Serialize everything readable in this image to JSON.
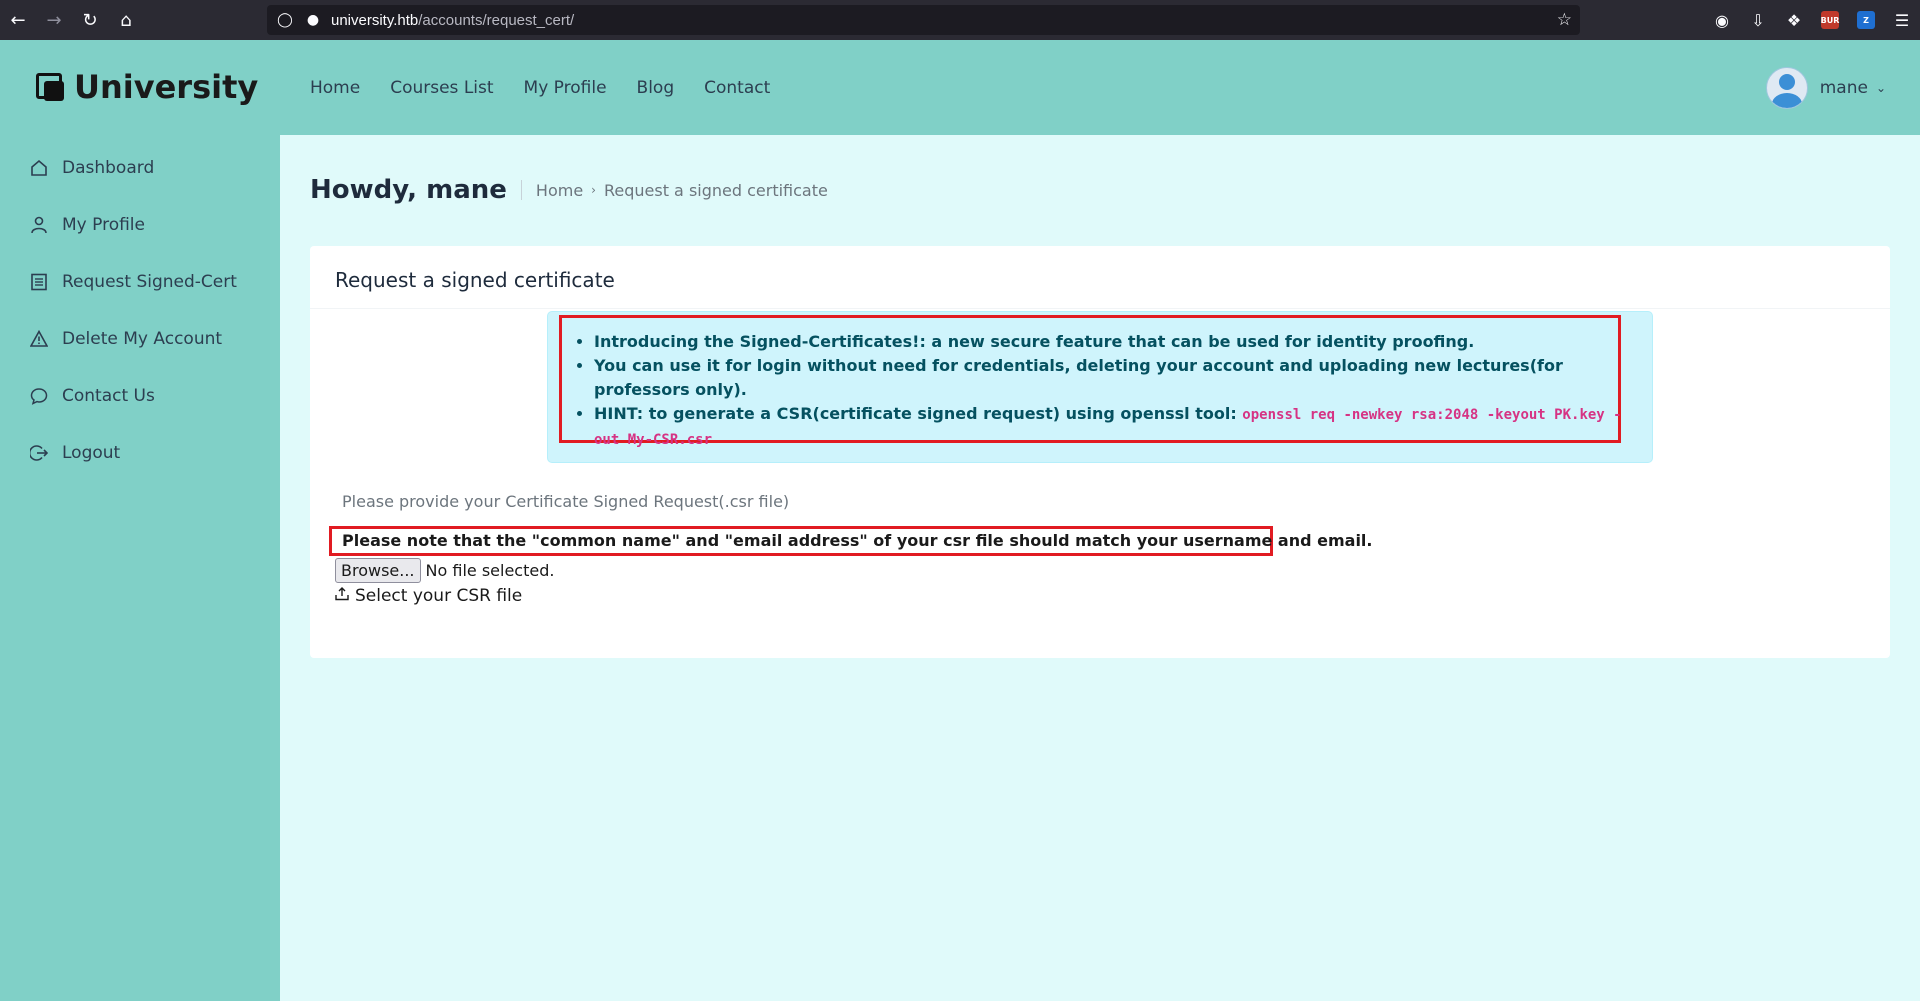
{
  "browser": {
    "url_host": "university.htb",
    "url_path": "/accounts/request_cert/",
    "extension_badge": "BUR"
  },
  "header": {
    "logo_text": "University",
    "nav": [
      "Home",
      "Courses List",
      "My Profile",
      "Blog",
      "Contact"
    ],
    "username": "mane"
  },
  "sidebar": {
    "items": [
      {
        "label": "Dashboard",
        "icon": "house-icon"
      },
      {
        "label": "My Profile",
        "icon": "person-icon"
      },
      {
        "label": "Request Signed-Cert",
        "icon": "document-icon"
      },
      {
        "label": "Delete My Account",
        "icon": "warning-icon"
      },
      {
        "label": "Contact Us",
        "icon": "chat-icon"
      },
      {
        "label": "Logout",
        "icon": "logout-icon"
      }
    ]
  },
  "page": {
    "greeting": "Howdy, mane",
    "breadcrumb_home": "Home",
    "breadcrumb_current": "Request a signed certificate"
  },
  "card": {
    "title": "Request a signed certificate",
    "alert": {
      "item1": "Introducing the Signed-Certificates!: a new secure feature that can be used for identity proofing.",
      "item2": "You can use it for login without need for credentials, deleting your account and uploading new lectures(for professors only).",
      "item3_label": "HINT:",
      "item3_text": " to generate a CSR(certificate signed request) using openssl tool: ",
      "item3_code": "openssl req -newkey rsa:2048 -keyout PK.key -out My-CSR.csr"
    },
    "provide_text": "Please provide your Certificate Signed Request(.csr file)",
    "note_text": "Please note that the \"common name\" and \"email address\" of your csr file should match your username and email.",
    "browse_label": "Browse...",
    "no_file_text": "No file selected.",
    "select_label": "Select your CSR file"
  },
  "colors": {
    "header_bg": "#80d0c7",
    "page_bg": "#e0fafa",
    "alert_bg": "#cff4fc",
    "highlight_border": "#e11b22"
  }
}
